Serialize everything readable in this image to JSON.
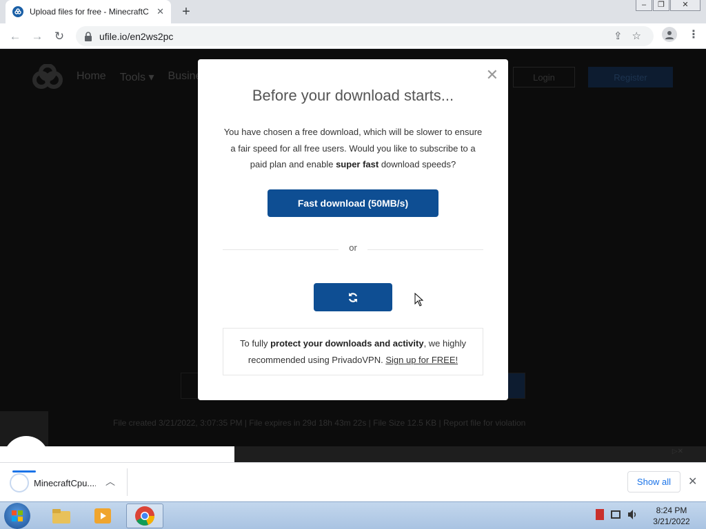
{
  "browser": {
    "tab_title": "Upload files for free - MinecraftC",
    "url": "ufile.io/en2ws2pc",
    "window_controls": [
      "minimize",
      "restore",
      "close"
    ]
  },
  "site": {
    "nav": [
      "Home",
      "Tools",
      "Busine"
    ],
    "login_label": "Login",
    "register_label": "Register",
    "file_info": "File created 3/21/2022, 3:07:35 PM   |   File expires in 29d 18h 43m 22s   |   File Size 12.5 KB   |   Report file for violation"
  },
  "modal": {
    "title": "Before your download starts...",
    "intro_1": "You have chosen a free download, which will be slower to ensure a fair speed for all free users. Would you like to subscribe to a paid plan and enable ",
    "intro_bold": "super fast",
    "intro_2": " download speeds?",
    "fast_button": "Fast download (50MB/s)",
    "or_text": "or",
    "slow_button_icon": "refresh-icon",
    "vpn_1": "To fully ",
    "vpn_bold": "protect your downloads and activity",
    "vpn_2": ", we highly recommended using PrivadoVPN. ",
    "vpn_link": "Sign up for FREE!"
  },
  "downloads": {
    "file_name": "MinecraftCpu....",
    "show_all": "Show all"
  },
  "taskbar": {
    "time": "8:24 PM",
    "date": "3/21/2022"
  }
}
